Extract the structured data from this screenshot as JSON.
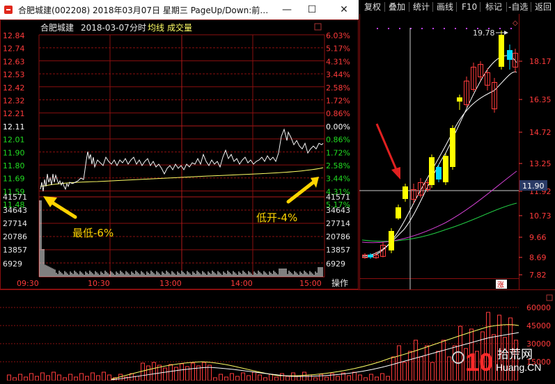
{
  "window": {
    "title": "合肥城建(002208) 2018年03月07日 星期三 PageUp/Down:前…",
    "minimize_label": "—",
    "maximize_label": "☐",
    "close_label": "✕"
  },
  "intraday": {
    "stock_name": "合肥城建",
    "date_label": "2018-03-07",
    "mode_label": "分时",
    "avg_label": "均线",
    "volume_label": "成交量",
    "price_ticks": [
      "12.84",
      "12.74",
      "12.63",
      "12.53",
      "12.42",
      "12.32",
      "12.21",
      "12.11",
      "12.01",
      "11.90",
      "11.80",
      "11.69",
      "11.59",
      "11.48"
    ],
    "pct_ticks": [
      "6.03%",
      "5.17%",
      "4.31%",
      "3.44%",
      "2.58%",
      "1.72%",
      "0.86%",
      "0.00%",
      "0.86%",
      "1.72%",
      "2.58%",
      "3.44%",
      "4.31%",
      "5.17%"
    ],
    "volume_ticks": [
      "41571",
      "34643",
      "27714",
      "20786",
      "13857",
      "6929"
    ],
    "time_ticks": [
      "09:30",
      "10:30",
      "13:00",
      "14:00",
      "15:00"
    ],
    "operate_label": "操作",
    "annotation_low": "最低-6%",
    "annotation_open": "低开-4%",
    "colors": {
      "up": "#ff3b3b",
      "down": "#22dd22",
      "zero": "#ffffff",
      "grid": "#8a0f0f",
      "avg": "#ffff66",
      "price": "#ffffff",
      "arrow": "#ffd400"
    }
  },
  "right_toolbar": {
    "items": [
      "复权",
      "叠加",
      "统计",
      "画线",
      "F10",
      "标记",
      "-自选",
      "返回"
    ]
  },
  "daily_chart": {
    "price_ticks": [
      "18.17",
      "16.35",
      "14.72",
      "13.25",
      "11.92",
      "10.73",
      "9.66",
      "8.69",
      "7.82"
    ],
    "high_label": "19.78",
    "current_price_label": "11.90",
    "zhang_label": "涨"
  },
  "volume_chart": {
    "ticks": [
      "60000",
      "45000",
      "30000",
      "15000"
    ]
  },
  "watermark": {
    "brand": "10",
    "site": "拾荒网",
    "domain": "Huang.CN"
  }
}
